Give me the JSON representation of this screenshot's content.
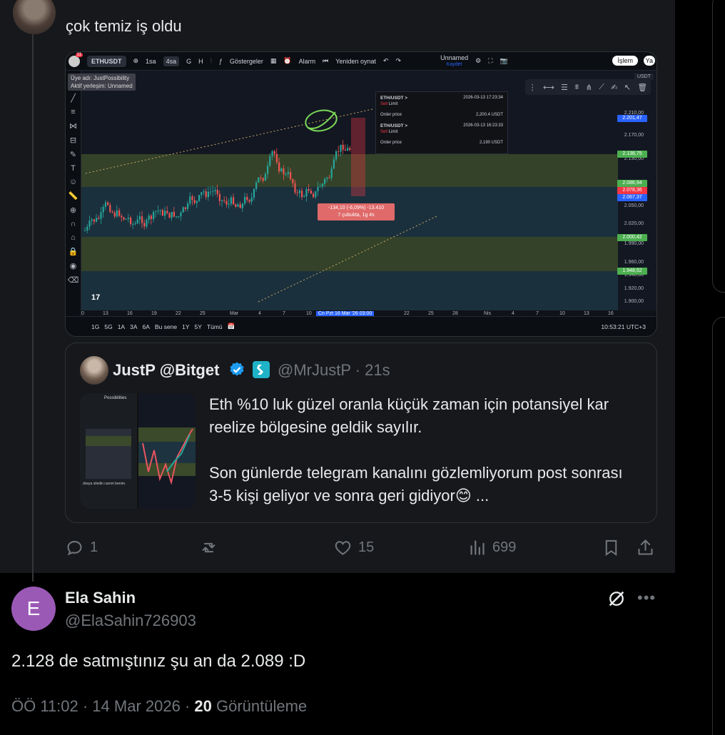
{
  "thread_post": {
    "text": "çok temiz iş oldu",
    "chart_image": {
      "symbol": "ETHUSDT",
      "badge": "11",
      "intervals": [
        "1sa",
        "4sa",
        "G",
        "H"
      ],
      "active_interval": "4sa",
      "indicators_label": "Göstergeler",
      "alarm_label": "Alarm",
      "replay_label": "Yeniden oynat",
      "layout_name": "Unnamed",
      "layout_saved": "Kaydet",
      "trade_label": "İşlem",
      "publish_label": "Ya",
      "currency": "USDT",
      "user_info_1": "Üye adı: JustPossibility",
      "user_info_2": "Aktif yerleşim: Unnamed",
      "orders": [
        {
          "pair": "ETH/USDT >",
          "side": "Sell",
          "type": "Limit",
          "time": "2026-03-13 17:23:34",
          "price_label": "Order price",
          "price": "2,200.4 USDT"
        },
        {
          "pair": "ETH/USDT >",
          "side": "Sell",
          "type": "Limit",
          "time": "2026-03-13 16:23:33",
          "price_label": "Order price",
          "price": "2,190 USDT"
        }
      ],
      "measure_line1": "-134,10 (-6,09%) -13.410",
      "measure_line2": "7 çubukta, 1g 4s",
      "price_axis": [
        "2.210,00",
        "2.170,00",
        "2.130,00",
        "2.050,00",
        "2.020,00",
        "1.990,00",
        "1.960,00",
        "1.940,00",
        "1.920,00",
        "1.900,00"
      ],
      "price_tags": [
        {
          "value": "2.201,47",
          "color": "#2962ff"
        },
        {
          "value": "2.138,75",
          "color": "#4caf50"
        },
        {
          "value": "2.086,94",
          "color": "#4caf50"
        },
        {
          "value": "2.078,36",
          "color": "#f23645"
        },
        {
          "value": "2.067,37",
          "color": "#2962ff"
        },
        {
          "value": "2.000,42",
          "color": "#4caf50"
        },
        {
          "value": "1.948,52",
          "color": "#4caf50"
        }
      ],
      "x_axis": [
        "0",
        "13",
        "16",
        "19",
        "22",
        "25",
        "Mar",
        "4",
        "7",
        "10",
        "22",
        "25",
        "28",
        "Nis",
        "4",
        "7",
        "10",
        "13",
        "16"
      ],
      "x_cursor_prefix": "Cn",
      "x_cursor": "Pzt 16 Mar '26   03:00",
      "ranges": [
        "1G",
        "5G",
        "1A",
        "3A",
        "6A",
        "Bu sene",
        "1Y",
        "5Y",
        "Tümü"
      ],
      "clock": "10:53:21 UTC+3",
      "logo": "17"
    },
    "quote": {
      "name": "JustP @Bitget",
      "handle": "@MrJustP · 21s",
      "paragraph1": "Eth %10 luk güzel oranla küçük zaman için potansiyel kar reelize bölgesine geldik sayılır.",
      "paragraph2": "Son günlerde telegram kanalını gözlemliyorum post sonrası 3-5 kişi geliyor ve sonra geri gidiyor😊 ...",
      "thumb_title": "Possibilities",
      "thumb_caption": "dosya izledin canım benim."
    },
    "actions": {
      "replies": "1",
      "reposts": "",
      "likes": "15",
      "views": "699"
    }
  },
  "reply": {
    "avatar_letter": "E",
    "name": "Ela Sahin",
    "handle": "@ElaSahin726903",
    "text": "2.128 de satmıştınız şu an da 2.089 :D",
    "time": "ÖÖ 11:02 · 14 Mar 2026 · ",
    "views_count": "20",
    "views_label": " Görüntüleme"
  },
  "colors": {
    "background": "#000000",
    "upper_background": "#16181c",
    "muted": "#71767b",
    "verified": "#1d9bf0",
    "avatar_purple": "#9b59b6"
  }
}
